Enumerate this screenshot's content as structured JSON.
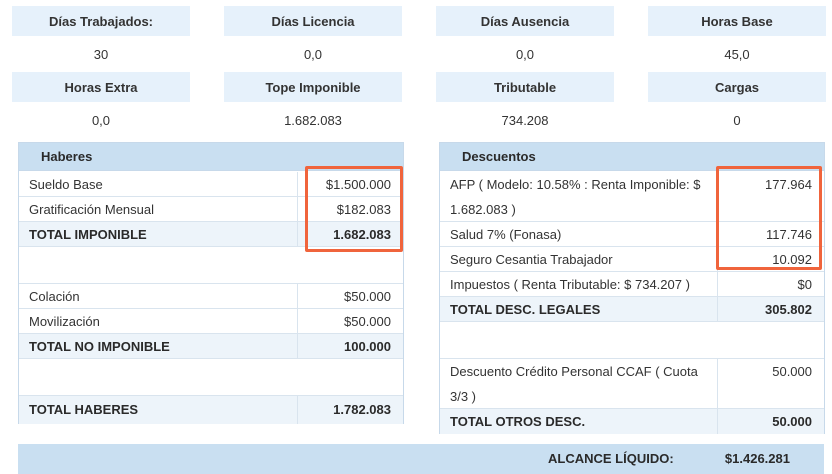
{
  "summary": {
    "dias_trabajados": {
      "label": "Días Trabajados:",
      "value": "30"
    },
    "dias_licencia": {
      "label": "Días Licencia",
      "value": "0,0"
    },
    "dias_ausencia": {
      "label": "Días Ausencia",
      "value": "0,0"
    },
    "horas_base": {
      "label": "Horas Base",
      "value": "45,0"
    },
    "horas_extra": {
      "label": "Horas Extra",
      "value": "0,0"
    },
    "tope_imponible": {
      "label": "Tope Imponible",
      "value": "1.682.083"
    },
    "tributable": {
      "label": "Tributable",
      "value": "734.208"
    },
    "cargas": {
      "label": "Cargas",
      "value": "0"
    }
  },
  "haberes": {
    "title": "Haberes",
    "sueldo_base": {
      "label": "Sueldo Base",
      "amount": "$1.500.000"
    },
    "gratificacion": {
      "label": "Gratificación Mensual",
      "amount": "$182.083"
    },
    "total_imponible": {
      "label": "TOTAL IMPONIBLE",
      "amount": "1.682.083"
    },
    "colacion": {
      "label": "Colación",
      "amount": "$50.000"
    },
    "movilizacion": {
      "label": "Movilización",
      "amount": "$50.000"
    },
    "total_no_imponible": {
      "label": "TOTAL NO IMPONIBLE",
      "amount": "100.000"
    },
    "total_haberes": {
      "label": "TOTAL HABERES",
      "amount": "1.782.083"
    }
  },
  "descuentos": {
    "title": "Descuentos",
    "afp": {
      "label_line1": "AFP ( Modelo: 10.58% : Renta Imponible: $",
      "label_line2": "1.682.083 )",
      "amount": "177.964"
    },
    "salud": {
      "label": "Salud 7% (Fonasa)",
      "amount": "117.746"
    },
    "seguro_cesantia": {
      "label": "Seguro Cesantia Trabajador",
      "amount": "10.092"
    },
    "impuestos": {
      "label": "Impuestos ( Renta Tributable: $ 734.207 )",
      "amount": "$0"
    },
    "total_legales": {
      "label": "TOTAL DESC. LEGALES",
      "amount": "305.802"
    },
    "credito_ccaf": {
      "label_line1": "Descuento Crédito Personal CCAF ( Cuota",
      "label_line2": "3/3 )",
      "amount": "50.000"
    },
    "total_otros": {
      "label": "TOTAL OTROS DESC.",
      "amount": "50.000"
    }
  },
  "alcance_liquido": {
    "label": "ALCANCE LÍQUIDO:",
    "amount": "$1.426.281"
  },
  "colors": {
    "highlight": "#f0643c",
    "header_bg": "#e6f1fb",
    "panel_title_bg": "#c9dff1"
  }
}
